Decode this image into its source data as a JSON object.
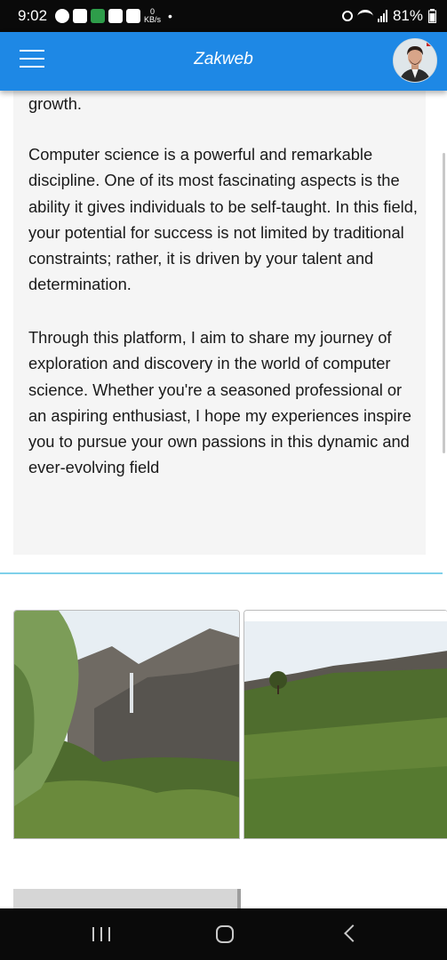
{
  "status_bar": {
    "time": "9:02",
    "speed_value": "0",
    "speed_unit": "KB/s",
    "battery": "81%"
  },
  "app_bar": {
    "title": "Zakweb",
    "menu_icon": "hamburger-menu-icon",
    "avatar": "user-avatar"
  },
  "content": {
    "paragraph_cut": "growth.",
    "paragraph_1": "Computer science is a powerful and remarkable discipline. One of its most fascinating aspects is the ability it gives individuals to be self-taught. In this field, your potential for success is not limited by traditional constraints; rather, it is driven by your talent and determination.",
    "paragraph_2": "Through this platform, I aim to share my journey of exploration and discovery in the world of computer science. Whether you're a seasoned professional or an aspiring enthusiast, I hope my experiences inspire you to pursue your own passions in this dynamic and ever-evolving field"
  },
  "gallery": {
    "images": [
      "mountain-waterfall-photo",
      "terraced-hillside-photo"
    ]
  },
  "colors": {
    "app_bar": "#1e88e5",
    "divider": "#7fd0ea",
    "card_bg": "#f5f5f5"
  },
  "nav_bar": {
    "icons": [
      "recent-apps-icon",
      "home-icon",
      "back-icon"
    ]
  }
}
